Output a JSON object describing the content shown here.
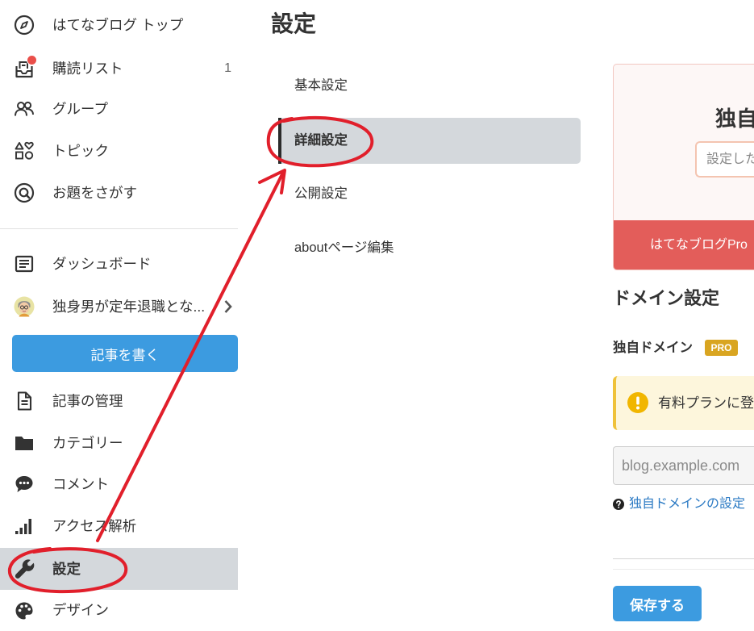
{
  "sidebar": {
    "global_nav": [
      {
        "label": "はてなブログ トップ",
        "icon": "compass-icon"
      },
      {
        "label": "購読リスト",
        "icon": "subscription-icon",
        "badge": "1",
        "has_notification_dot": true
      },
      {
        "label": "グループ",
        "icon": "group-icon"
      },
      {
        "label": "トピック",
        "icon": "topic-icon"
      },
      {
        "label": "お題をさがす",
        "icon": "odai-icon"
      }
    ],
    "dashboard": {
      "label": "ダッシュボード",
      "icon": "dashboard-icon"
    },
    "blog_name": "独身男が定年退職とな...",
    "write_button": "記事を書く",
    "blog_nav": [
      {
        "label": "記事の管理",
        "icon": "document-icon"
      },
      {
        "label": "カテゴリー",
        "icon": "folder-icon"
      },
      {
        "label": "コメント",
        "icon": "comment-icon"
      },
      {
        "label": "アクセス解析",
        "icon": "analytics-icon"
      },
      {
        "label": "設定",
        "icon": "wrench-icon",
        "active": true
      },
      {
        "label": "デザイン",
        "icon": "palette-icon"
      }
    ]
  },
  "settings": {
    "title": "設定",
    "tabs": [
      {
        "label": "基本設定"
      },
      {
        "label": "詳細設定",
        "active": true
      },
      {
        "label": "公開設定"
      },
      {
        "label": "aboutページ編集"
      }
    ]
  },
  "promo": {
    "title": "独自",
    "input_placeholder": "設定した",
    "banner_text": "はてなブログPro"
  },
  "domain": {
    "heading": "ドメイン設定",
    "custom_domain": {
      "label": "独自ドメイン",
      "badge": "PRO",
      "notice": "有料プランに登",
      "placeholder": "blog.example.com",
      "help_link": "独自ドメインの設定"
    },
    "save_button": "保存する"
  },
  "colors": {
    "accent_blue": "#3c9be0",
    "active_bg": "#d4d8dc",
    "promo_red": "#e35d5a",
    "pro_badge": "#d9a521",
    "warning_icon": "#f1b600",
    "link": "#2d7bc4",
    "annotation_red": "#e11f2b"
  }
}
